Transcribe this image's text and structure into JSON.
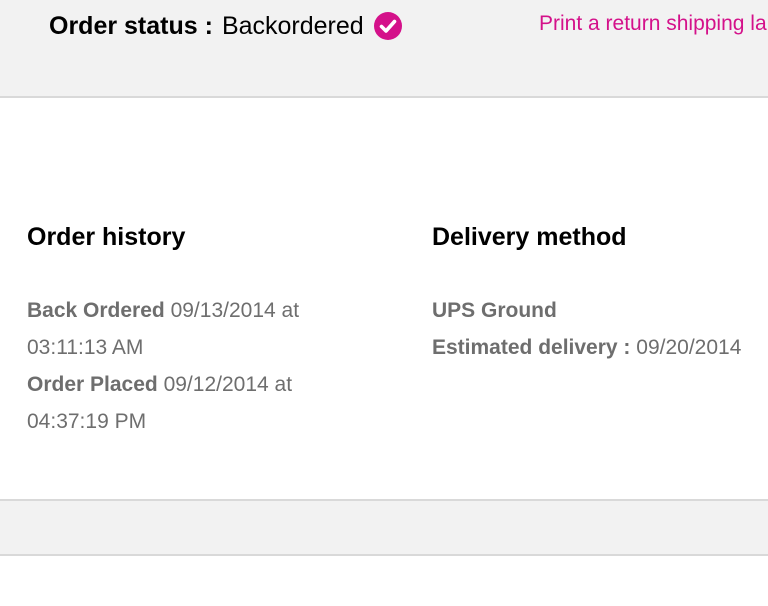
{
  "header": {
    "status_label": "Order status :",
    "status_value": "Backordered",
    "status_icon": "check-circle-icon",
    "return_link": "Print a return shipping label"
  },
  "order_history": {
    "title": "Order history",
    "entries": [
      {
        "label": "Back Ordered",
        "value": "09/13/2014 at 03:11:13 AM"
      },
      {
        "label": "Order Placed",
        "value": "09/12/2014 at 04:37:19 PM"
      }
    ]
  },
  "delivery": {
    "title": "Delivery method",
    "method": "UPS Ground",
    "estimate_label": "Estimated delivery :",
    "estimate_value": "09/20/2014"
  },
  "colors": {
    "accent": "#d4118a",
    "muted_text": "#6e6e6e",
    "panel_bg": "#f2f2f2"
  }
}
